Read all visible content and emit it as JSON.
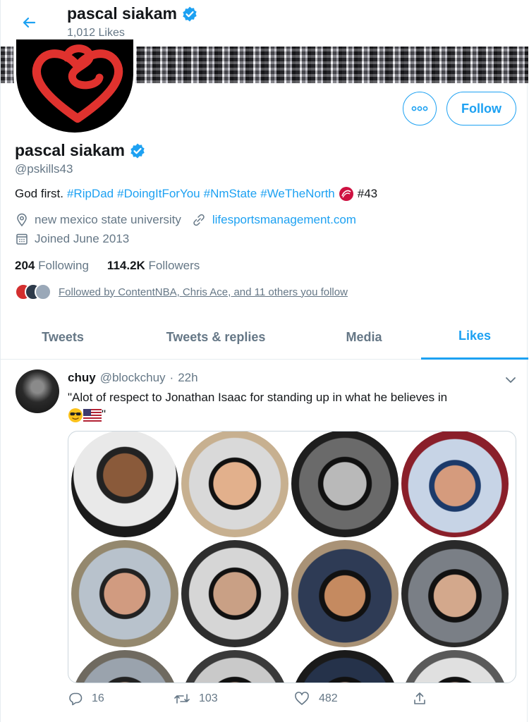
{
  "header": {
    "name": "pascal siakam",
    "likes_count": "1,012 Likes"
  },
  "profile": {
    "name": "pascal siakam",
    "handle": "@pskills43",
    "bio_prefix": "God first.",
    "bio_tags": [
      "#RipDad",
      "#DoingItForYou",
      "#NmState",
      "#WeTheNorth"
    ],
    "bio_suffix": "#43",
    "location": "new mexico state university",
    "website": "lifesportsmanagement.com",
    "joined": "Joined June 2013",
    "following_count": "204",
    "following_label": "Following",
    "followers_count": "114.2K",
    "followers_label": "Followers",
    "followed_by": "Followed by ContentNBA, Chris Ace, and 11 others you follow",
    "follow_label": "Follow"
  },
  "tabs": [
    {
      "label": "Tweets"
    },
    {
      "label": "Tweets & replies"
    },
    {
      "label": "Media"
    },
    {
      "label": "Likes"
    }
  ],
  "tweet": {
    "display_name": "chuy",
    "handle": "@blockchuy",
    "separator": "·",
    "time": "22h",
    "text": "\"Alot of respect to Jonathan Isaac for standing up in what he believes in",
    "text_end": "\"",
    "replies": "16",
    "retweets": "103",
    "likes": "482"
  },
  "colors": {
    "accent": "#1da1f2",
    "muted": "#657786",
    "text": "#14171a"
  },
  "icons": [
    "back-arrow-icon",
    "verified-badge-icon",
    "location-icon",
    "link-icon",
    "calendar-icon",
    "more-icon",
    "reply-icon",
    "retweet-icon",
    "like-icon",
    "share-icon",
    "chevron-down-icon"
  ]
}
